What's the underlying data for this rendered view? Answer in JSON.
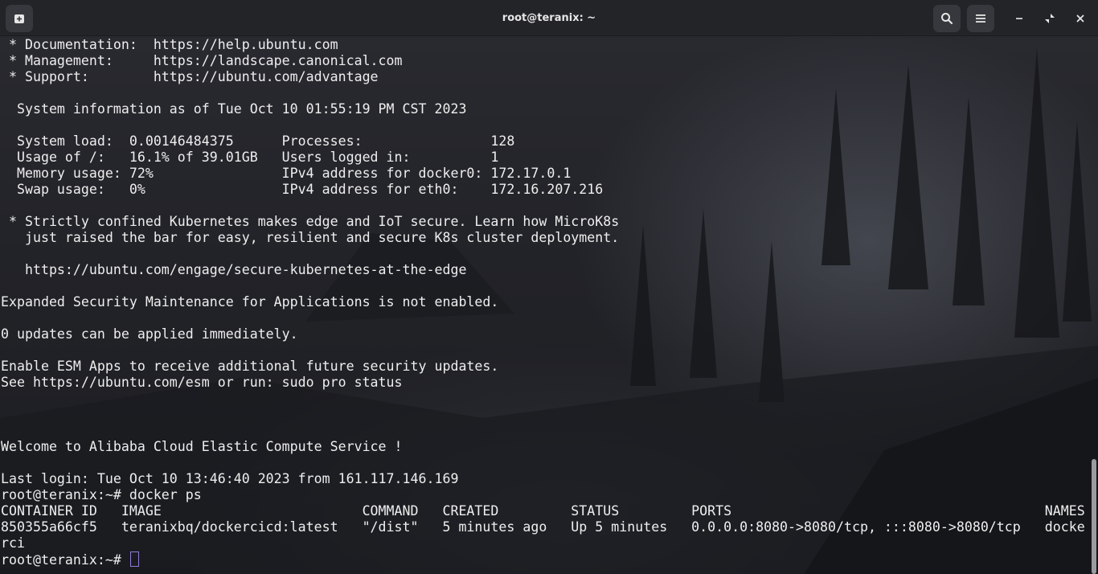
{
  "window": {
    "title": "root@teranix: ~"
  },
  "titlebar_icons": {
    "new_tab": "new-tab-icon",
    "search": "search-icon",
    "menu": "hamburger-menu-icon",
    "minimize": "minimize-icon",
    "restore": "restore-icon",
    "close": "close-icon"
  },
  "terminal": {
    "output": " * Documentation:  https://help.ubuntu.com\n * Management:     https://landscape.canonical.com\n * Support:        https://ubuntu.com/advantage\n\n  System information as of Tue Oct 10 01:55:19 PM CST 2023\n\n  System load:  0.00146484375      Processes:                128\n  Usage of /:   16.1% of 39.01GB   Users logged in:          1\n  Memory usage: 72%                IPv4 address for docker0: 172.17.0.1\n  Swap usage:   0%                 IPv4 address for eth0:    172.16.207.216\n\n * Strictly confined Kubernetes makes edge and IoT secure. Learn how MicroK8s\n   just raised the bar for easy, resilient and secure K8s cluster deployment.\n\n   https://ubuntu.com/engage/secure-kubernetes-at-the-edge\n\nExpanded Security Maintenance for Applications is not enabled.\n\n0 updates can be applied immediately.\n\nEnable ESM Apps to receive additional future security updates.\nSee https://ubuntu.com/esm or run: sudo pro status\n\n\n\nWelcome to Alibaba Cloud Elastic Compute Service !\n\nLast login: Tue Oct 10 13:46:40 2023 from 161.117.146.169\nroot@teranix:~# docker ps\nCONTAINER ID   IMAGE                         COMMAND   CREATED         STATUS         PORTS                                       NAMES\n850355a66cf5   teranixbq/dockercicd:latest   \"/dist\"   5 minutes ago   Up 5 minutes   0.0.0.0:8080->8080/tcp, :::8080->8080/tcp   docke\nrci",
    "prompt": "root@teranix:~# "
  },
  "colors": {
    "titlebar": "#232428",
    "text": "#eeeeee",
    "cursor": "#8f7ad8"
  }
}
